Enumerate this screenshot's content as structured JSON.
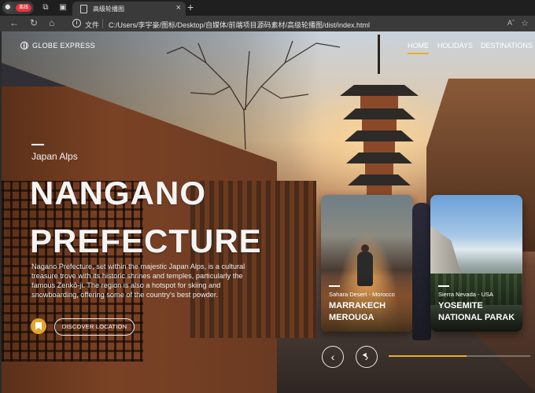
{
  "browser": {
    "profile_badge": "离线",
    "tab_title": "高级轮播图",
    "scheme_label": "文件",
    "url": "C:/Users/李宇豪/图标/Desktop/自媒体/前端项目源码素材/高级轮播图/dist/index.html",
    "read_aloud": "Aˆ"
  },
  "site": {
    "brand": "GLOBE EXPRESS",
    "nav": [
      "HOME",
      "HOLIDAYS",
      "DESTINATIONS"
    ]
  },
  "hero": {
    "region": "Japan Alps",
    "title_line1": "NANGANO",
    "title_line2": "PREFECTURE",
    "description": "Nagano Prefecture, set within the majestic Japan Alps, is a cultural treasure trove with its historic shrines and temples, particularly the famous Zenkō-ji. The region is also a hotspot for skiing and snowboarding, offering some of the country's best powder.",
    "cta": "DISCOVER LOCATION"
  },
  "cards": [
    {
      "location": "Sahara Desert - Morocco",
      "name_line1": "MARRAKECH",
      "name_line2": "MEROUGA"
    },
    {
      "location": "Sierra Nevada - USA",
      "name_line1": "YOSEMITE",
      "name_line2": "NATIONAL PARAK"
    }
  ],
  "controls": {
    "prev": "‹",
    "next": "›",
    "progress": 0.55
  },
  "colors": {
    "accent": "#ecad29",
    "badge": "#e8343c"
  }
}
